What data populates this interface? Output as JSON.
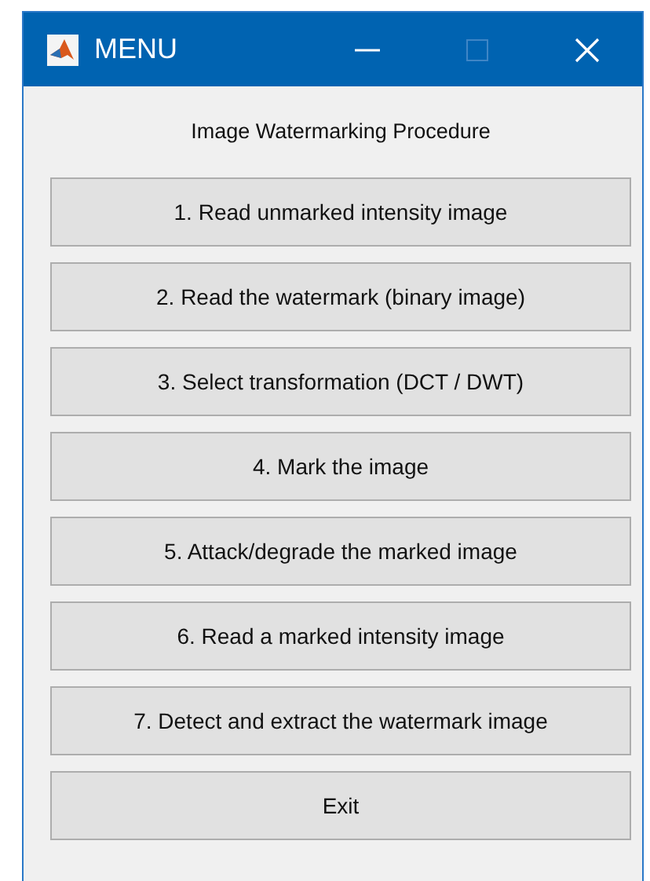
{
  "window": {
    "title": "MENU",
    "maximize_disabled": true
  },
  "heading": "Image Watermarking Procedure",
  "buttons": [
    "1. Read unmarked intensity image",
    "2. Read the watermark (binary image)",
    "3. Select transformation (DCT / DWT)",
    "4. Mark the image",
    "5. Attack/degrade the marked image",
    "6. Read a marked intensity image",
    "7. Detect and extract the watermark image",
    "Exit"
  ]
}
